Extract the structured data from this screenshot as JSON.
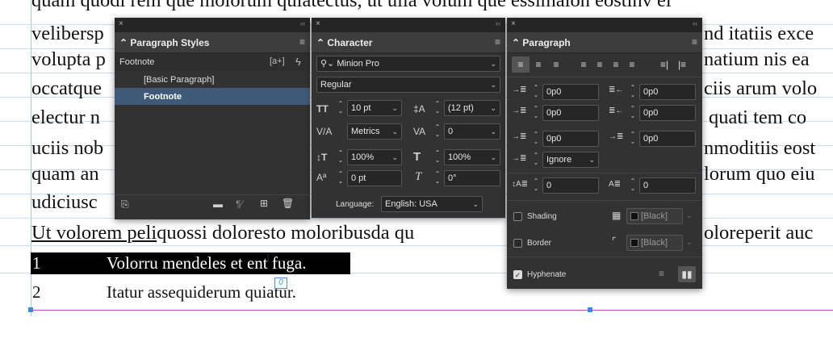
{
  "document": {
    "lines": [
      "quam quodi rem que molorum quiatectus, ut ulla volum que essimalon eostinv el",
      "velibersp",
      "volupta p",
      "occatque",
      "electur n",
      "uciis nob",
      "quam an",
      "udiciusc",
      "Ut volorem peliquossi doloresto moloribusda qu"
    ],
    "right_lines": [
      "nd itatiis exce",
      "natium nis ea",
      "ciis arum volo",
      "quati tem co",
      "nmoditiis eost",
      "lorum quo eiu",
      "",
      "oloreperit auc"
    ],
    "footnotes": [
      {
        "number": "1",
        "text": "Volorru mendeles et ent fuga."
      },
      {
        "number": "2",
        "text": "Itatur assequiderum quiatur."
      }
    ],
    "footnote_marker": "0"
  },
  "paragraph_styles": {
    "title": "Paragraph Styles",
    "current": "Footnote",
    "items": [
      "[Basic Paragraph]",
      "Footnote"
    ],
    "selected": "Footnote",
    "new_group_icon": "[a+]"
  },
  "character": {
    "title": "Character",
    "font_family": "Minion Pro",
    "font_style": "Regular",
    "size": "10 pt",
    "leading": "(12 pt)",
    "kerning": "Metrics",
    "tracking": "0",
    "vertical_scale": "100%",
    "horizontal_scale": "100%",
    "baseline_shift": "0 pt",
    "skew": "0°",
    "language_label": "Language:",
    "language": "English: USA"
  },
  "paragraph": {
    "title": "Paragraph",
    "left_indent": "0p0",
    "right_indent": "0p0",
    "first_line_indent": "0p0",
    "last_line_indent": "0p0",
    "space_before": "0p0",
    "space_after": "0p0",
    "drop_cap_align": "Ignore",
    "drop_cap_lines": "0",
    "drop_cap_chars": "0",
    "shading_label": "Shading",
    "border_label": "Border",
    "shading_color": "[Black]",
    "border_color": "[Black]",
    "hyphenate_label": "Hyphenate",
    "hyphenate_checked": true
  }
}
